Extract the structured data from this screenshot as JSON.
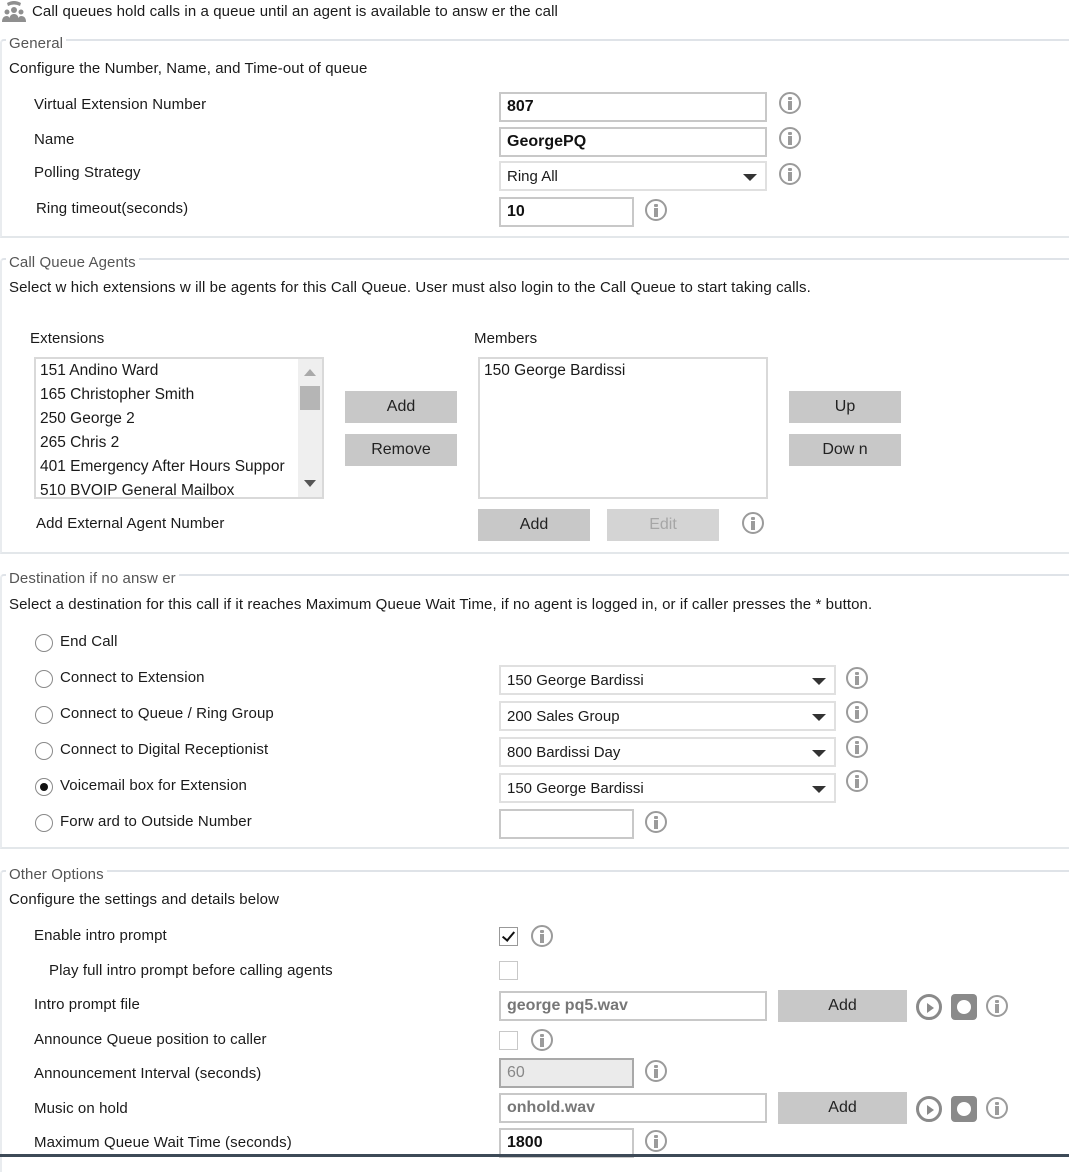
{
  "header": {
    "icon": "call-queue-people-icon",
    "description": "Call queues hold calls in a queue until an agent is available to answ er the call"
  },
  "general": {
    "legend": "General",
    "description": "Configure the Number, Name, and Time-out of queue",
    "fields": {
      "extension": {
        "label": "Virtual Extension Number",
        "value": "807"
      },
      "name": {
        "label": "Name",
        "value": "GeorgePQ"
      },
      "polling": {
        "label": "Polling Strategy",
        "value": "Ring All"
      },
      "ring_timeout": {
        "label": "Ring timeout(seconds)",
        "value": "10"
      }
    }
  },
  "agents": {
    "legend": "Call Queue Agents",
    "description": "Select w hich extensions w ill be agents for this Call Queue. User must also login to the Call Queue to start taking calls.",
    "extensions_label": "Extensions",
    "members_label": "Members",
    "extensions": [
      "151 Andino Ward",
      "165 Christopher Smith",
      "250 George 2",
      "265 Chris 2",
      "401 Emergency After Hours Suppor",
      "510 BVOIP General Mailbox"
    ],
    "members": [
      "150 George Bardissi"
    ],
    "add_label": "Add",
    "remove_label": "Remove",
    "up_label": "Up",
    "down_label": "Dow n",
    "external_label": "Add External Agent Number",
    "external_add_label": "Add",
    "external_edit_label": "Edit"
  },
  "destination": {
    "legend": "Destination if no answ er",
    "description": "Select a destination for this call if it reaches Maximum Queue Wait Time, if no agent is logged in, or if caller presses the * button.",
    "options": [
      {
        "label": "End Call",
        "selected": false
      },
      {
        "label": "Connect to Extension",
        "selected": false,
        "value": "150 George Bardissi"
      },
      {
        "label": "Connect to Queue / Ring Group",
        "selected": false,
        "value": "200 Sales Group"
      },
      {
        "label": "Connect to Digital Receptionist",
        "selected": false,
        "value": "800 Bardissi Day"
      },
      {
        "label": "Voicemail box  for Extension",
        "selected": true,
        "value": "150 George Bardissi"
      },
      {
        "label": "Forw ard to Outside Number",
        "selected": false,
        "value": ""
      }
    ]
  },
  "other": {
    "legend": "Other Options",
    "description": "Configure the settings and details below",
    "enable_intro": {
      "label": "Enable intro prompt",
      "checked": true
    },
    "play_full_intro": {
      "label": "Play full intro prompt before calling agents",
      "checked": false
    },
    "intro_file": {
      "label": "Intro prompt file",
      "value": "george pq5.wav",
      "add_label": "Add"
    },
    "announce_position": {
      "label": "Announce Queue position to caller",
      "checked": false
    },
    "announce_interval": {
      "label": "Announcement Interval (seconds)",
      "value": "60"
    },
    "music_on_hold": {
      "label": "Music on hold",
      "value": "onhold.wav",
      "add_label": "Add"
    },
    "max_wait": {
      "label": "Maximum Queue Wait Time (seconds)",
      "value": "1800"
    }
  }
}
